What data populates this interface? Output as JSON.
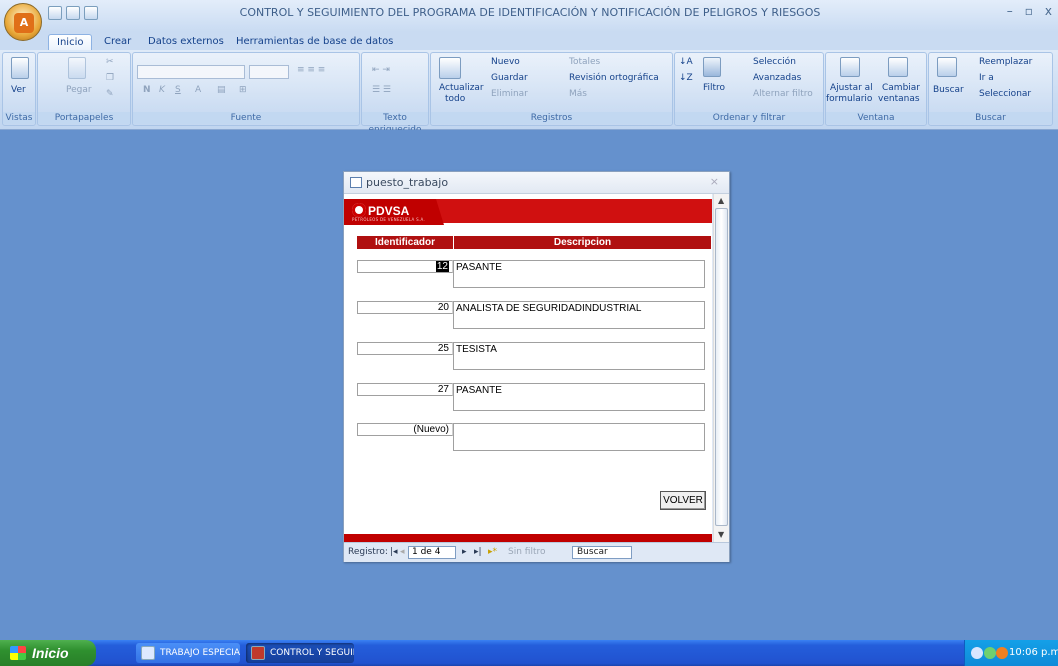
{
  "app": {
    "title": "CONTROL Y SEGUIMIENTO DEL PROGRAMA DE IDENTIFICACIÓN Y NOTIFICACIÓN DE PELIGROS Y RIESGOS"
  },
  "tabs": [
    "Inicio",
    "Crear",
    "Datos externos",
    "Herramientas de base de datos"
  ],
  "ribbon": {
    "vistas": {
      "ver": "Ver",
      "label": "Vistas"
    },
    "portapapeles": {
      "pegar": "Pegar",
      "label": "Portapapeles"
    },
    "fuente": {
      "label": "Fuente",
      "bold": "N",
      "italic": "K",
      "underline": "S"
    },
    "texto": {
      "label": "Texto enriquecido"
    },
    "registros": {
      "actualizar": "Actualizar",
      "todo": "todo",
      "nuevo": "Nuevo",
      "guardar": "Guardar",
      "eliminar": "Eliminar",
      "totales": "Totales",
      "revision": "Revisión ortográfica",
      "mas": "Más",
      "label": "Registros"
    },
    "ordenar": {
      "filtro": "Filtro",
      "seleccion": "Selección",
      "avanzadas": "Avanzadas",
      "alternar": "Alternar filtro",
      "label": "Ordenar y filtrar"
    },
    "ventana": {
      "ajustar1": "Ajustar al",
      "ajustar2": "formulario",
      "cambiar1": "Cambiar",
      "cambiar2": "ventanas",
      "label": "Ventana"
    },
    "buscar": {
      "buscar": "Buscar",
      "reemplazar": "Reemplazar",
      "ira": "Ir a",
      "seleccionar": "Seleccionar",
      "label": "Buscar"
    }
  },
  "form": {
    "title": "puesto_trabajo",
    "logo": "PDVSA",
    "logo_sub": "PETRÓLEOS DE VENEZUELA S.A.",
    "col_id": "Identificador",
    "col_desc": "Descripcion",
    "rows": [
      {
        "id": "12",
        "desc": "PASANTE"
      },
      {
        "id": "20",
        "desc": "ANALISTA DE SEGURIDADINDUSTRIAL"
      },
      {
        "id": "25",
        "desc": "TESISTA"
      },
      {
        "id": "27",
        "desc": "PASANTE"
      },
      {
        "id": "(Nuevo)",
        "desc": ""
      }
    ],
    "volver": "VOLVER",
    "nav": {
      "registro": "Registro:",
      "current": "1 de 4",
      "sin_filtro": "Sin filtro",
      "buscar": "Buscar"
    }
  },
  "taskbar": {
    "start": "Inicio",
    "items": [
      "TRABAJO ESPECIAL ...",
      "CONTROL Y SEGUIMI..."
    ],
    "clock": "10:06 p.m."
  }
}
